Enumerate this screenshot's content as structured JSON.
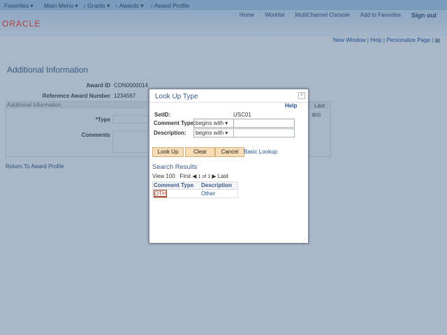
{
  "nav": {
    "favorites": "Favorites ▾",
    "main_menu": "Main Menu ▾",
    "grants": "› Grants ▾",
    "awards": "› Awards ▾",
    "award_profile": "› Award Profile"
  },
  "header": {
    "links": [
      "Home",
      "Worklist",
      "MultiChannel Console",
      "Add to Favorites",
      "Sign out"
    ],
    "logo": "ORACLE"
  },
  "toolbar": {
    "new_window": "New Window",
    "help": "Help",
    "personalize": "Personalize Page"
  },
  "page": {
    "title": "Additional Information",
    "award_id_label": "Award ID",
    "award_id": "CON0000014",
    "ref_label": "Reference Award Number",
    "ref": "1234567",
    "section": "Additional Information",
    "type_label": "*Type",
    "comments_label": "Comments",
    "last": "Last",
    "return_link": "Return To Award Profile"
  },
  "modal": {
    "title": "Look Up Type",
    "help": "Help",
    "setid_label": "SetID:",
    "setid": "USC01",
    "comment_type_label": "Comment Type:",
    "description_label": "Description:",
    "operator": "begins with",
    "lookup": "Look Up",
    "clear": "Clear",
    "cancel": "Cancel",
    "basic_lookup": "Basic Lookup",
    "results_title": "Search Results",
    "view": "View 100",
    "first": "First",
    "count": "1 of 1",
    "last": "Last",
    "columns": [
      "Comment Type",
      "Description"
    ],
    "rows": [
      [
        "OTH",
        "Other"
      ]
    ]
  }
}
